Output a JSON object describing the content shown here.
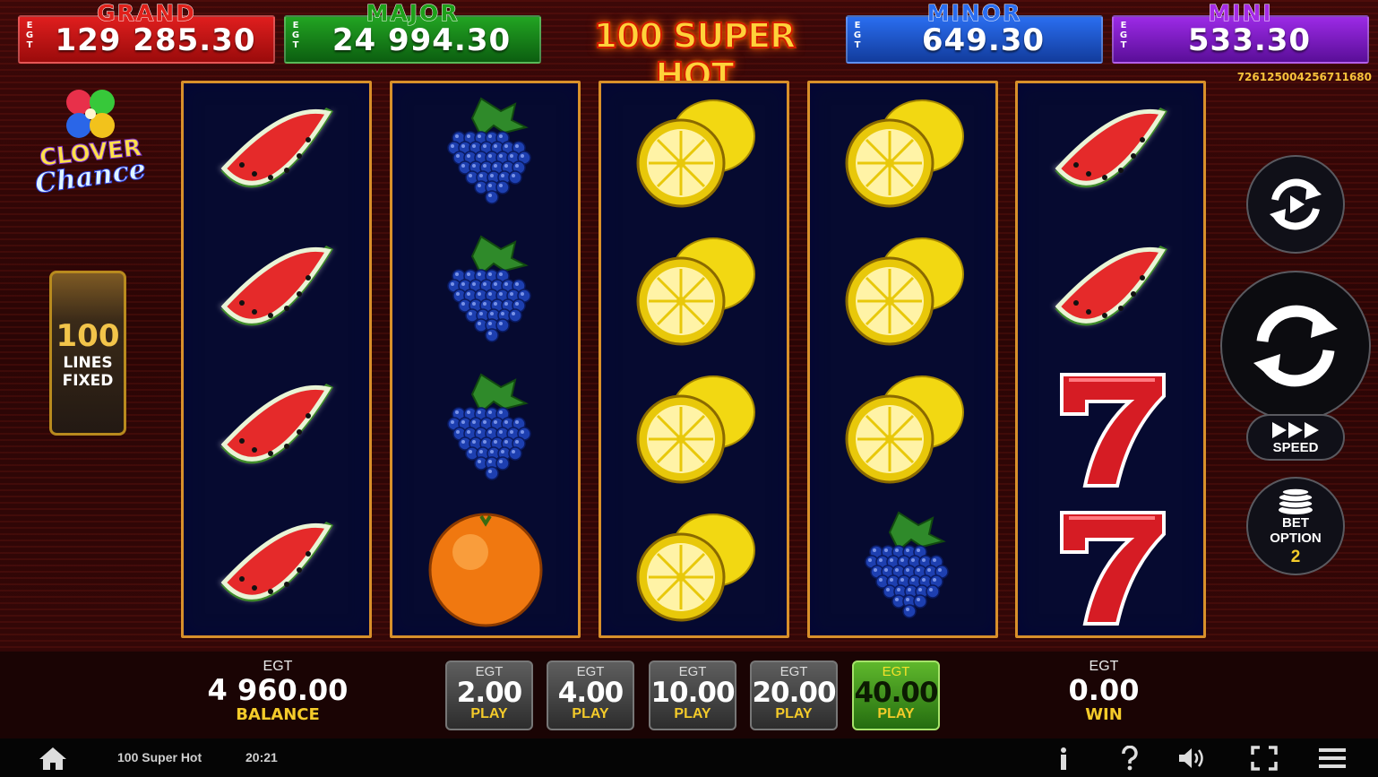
{
  "jackpots": [
    {
      "title": "GRAND",
      "value": "129 285.30",
      "egt": "E\nG\nT",
      "color": "#d4141a",
      "title_color": "#e0201a"
    },
    {
      "title": "MAJOR",
      "value": "24 994.30",
      "egt": "E\nG\nT",
      "color": "#1c8c1e",
      "title_color": "#1ea01a"
    },
    {
      "title": "MINOR",
      "value": "649.30",
      "egt": "E\nG\nT",
      "color": "#1e5ad6",
      "title_color": "#2a6df0"
    },
    {
      "title": "MINI",
      "value": "533.30",
      "egt": "E\nG\nT",
      "color": "#8a1ed0",
      "title_color": "#a52ae6"
    }
  ],
  "game_logo": "100 SUPER HOT",
  "serial_number": "726125004256711680",
  "clover_logo": {
    "line1": "CLOVER",
    "line2": "Chance"
  },
  "lines_panel": {
    "count": "100",
    "line1": "LINES",
    "line2": "FIXED"
  },
  "reels": [
    [
      "watermelon-icon",
      "watermelon-icon",
      "watermelon-icon",
      "watermelon-icon"
    ],
    [
      "grapes-icon",
      "grapes-icon",
      "grapes-icon",
      "orange-icon"
    ],
    [
      "lemon-icon",
      "lemon-icon",
      "lemon-icon",
      "lemon-icon"
    ],
    [
      "lemon-icon",
      "lemon-icon",
      "lemon-icon",
      "grapes-icon"
    ],
    [
      "watermelon-icon",
      "watermelon-icon",
      "seven-icon",
      "seven-icon"
    ]
  ],
  "side_buttons": {
    "speed_label": "SPEED",
    "bet_option_line1": "BET",
    "bet_option_line2": "OPTION",
    "bet_option_value": "2"
  },
  "balance": {
    "egt": "EGT",
    "value": "4 960.00",
    "label": "BALANCE"
  },
  "win": {
    "egt": "EGT",
    "value": "0.00",
    "label": "WIN"
  },
  "bets": [
    {
      "egt": "EGT",
      "value": "2.00",
      "label": "PLAY",
      "active": false
    },
    {
      "egt": "EGT",
      "value": "4.00",
      "label": "PLAY",
      "active": false
    },
    {
      "egt": "EGT",
      "value": "10.00",
      "label": "PLAY",
      "active": false
    },
    {
      "egt": "EGT",
      "value": "20.00",
      "label": "PLAY",
      "active": false
    },
    {
      "egt": "EGT",
      "value": "40.00",
      "label": "PLAY",
      "active": true
    }
  ],
  "status_bar": {
    "game_name": "100 Super Hot",
    "time": "20:21"
  },
  "colors": {
    "accent_gold": "#f4cb2a",
    "reel_border": "#d8902a",
    "active_bet": "#5fb82c"
  }
}
